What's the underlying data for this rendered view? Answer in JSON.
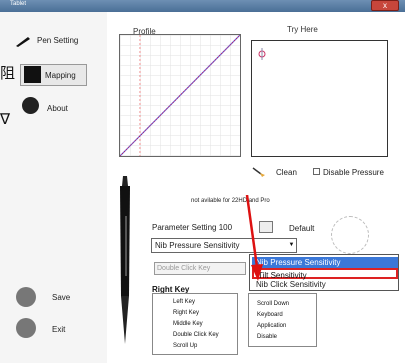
{
  "window": {
    "title": "Tablet",
    "close_label": "x"
  },
  "sidebar": {
    "fragments": [
      "阻",
      "∇"
    ],
    "items": [
      {
        "label": "Pen Setting"
      },
      {
        "label": "Mapping"
      },
      {
        "label": "About"
      }
    ],
    "actions": {
      "save_label": "Save",
      "exit_label": "Exit"
    }
  },
  "profile": {
    "label": "Profile",
    "curve": "linear"
  },
  "try_here": {
    "label": "Try Here"
  },
  "controls": {
    "clean_label": "Clean",
    "disable_pressure_label": "Disable Pressure"
  },
  "pen": {
    "notice": "not avilable for 22HD and Pro",
    "parameter_setting_label": "Parameter Setting",
    "parameter_value": "100",
    "default_label": "Default",
    "selected_option": "Nib Pressure Sensitivity",
    "dropdown_options": [
      "Nib Pressure Sensitivity",
      "Tilt Sensitivity",
      "Nib Click Sensitivity"
    ],
    "double_click_key_label": "Double Click Key",
    "right_key_label": "Right Key",
    "menu_items": [
      "Left Key",
      "Right Key",
      "Middle Key",
      "Double Click Key",
      "Scroll Up"
    ],
    "menu2_items": [
      "Scroll Down",
      "Keyboard",
      "Application",
      "Disable"
    ]
  }
}
